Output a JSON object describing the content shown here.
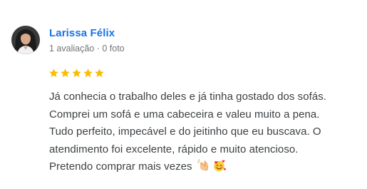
{
  "review": {
    "reviewer": {
      "name": "Larissa Félix",
      "meta": "1 avaliação · 0 foto",
      "avatar_icon": "profile-photo-icon"
    },
    "rating": {
      "value": 5,
      "max": 5,
      "star_color": "#fbbc04"
    },
    "text_lines": [
      "Já conhecia o trabalho deles e já tinha gostado dos sofás.",
      "Comprei um sofá e uma cabeceira e valeu muito a pena.",
      "Tudo perfeito, impecável e do jeitinho que eu buscava. O",
      "atendimento foi excelente, rápido e muito atencioso.",
      "Pretendo comprar mais vezes"
    ],
    "emojis": [
      "clapping-hands-emoji",
      "smiling-face-with-hearts-emoji"
    ]
  },
  "colors": {
    "name": "#1a73e8",
    "meta": "#70757a",
    "text": "#3c4043"
  }
}
